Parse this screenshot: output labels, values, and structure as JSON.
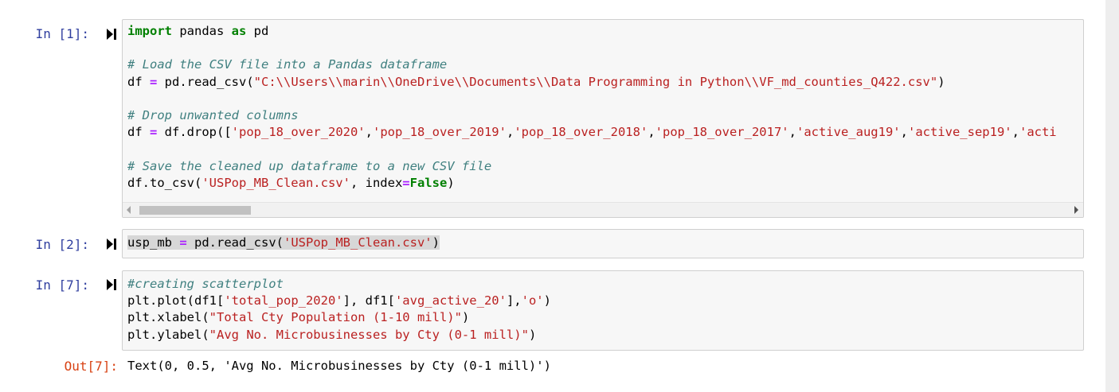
{
  "cells": [
    {
      "prompt": "In [1]:",
      "lines": [
        [
          {
            "t": "kw",
            "v": "import"
          },
          {
            "t": "",
            "v": " pandas "
          },
          {
            "t": "kw",
            "v": "as"
          },
          {
            "t": "",
            "v": " pd"
          }
        ],
        [],
        [
          {
            "t": "cm",
            "v": "# Load the CSV file into a Pandas dataframe"
          }
        ],
        [
          {
            "t": "",
            "v": "df "
          },
          {
            "t": "op",
            "v": "="
          },
          {
            "t": "",
            "v": " pd.read_csv("
          },
          {
            "t": "str",
            "v": "\"C:\\\\Users\\\\marin\\\\OneDrive\\\\Documents\\\\Data Programming in Python\\\\VF_md_counties_Q422.csv\""
          },
          {
            "t": "",
            "v": ")"
          }
        ],
        [],
        [
          {
            "t": "cm",
            "v": "# Drop unwanted columns"
          }
        ],
        [
          {
            "t": "",
            "v": "df "
          },
          {
            "t": "op",
            "v": "="
          },
          {
            "t": "",
            "v": " df.drop(["
          },
          {
            "t": "str",
            "v": "'pop_18_over_2020'"
          },
          {
            "t": "",
            "v": ","
          },
          {
            "t": "str",
            "v": "'pop_18_over_2019'"
          },
          {
            "t": "",
            "v": ","
          },
          {
            "t": "str",
            "v": "'pop_18_over_2018'"
          },
          {
            "t": "",
            "v": ","
          },
          {
            "t": "str",
            "v": "'pop_18_over_2017'"
          },
          {
            "t": "",
            "v": ","
          },
          {
            "t": "str",
            "v": "'active_aug19'"
          },
          {
            "t": "",
            "v": ","
          },
          {
            "t": "str",
            "v": "'active_sep19'"
          },
          {
            "t": "",
            "v": ","
          },
          {
            "t": "str",
            "v": "'acti"
          }
        ],
        [],
        [
          {
            "t": "cm",
            "v": "# Save the cleaned up dataframe to a new CSV file"
          }
        ],
        [
          {
            "t": "",
            "v": "df.to_csv("
          },
          {
            "t": "str",
            "v": "'USPop_MB_Clean.csv'"
          },
          {
            "t": "",
            "v": ", index"
          },
          {
            "t": "op",
            "v": "="
          },
          {
            "t": "kw",
            "v": "False"
          },
          {
            "t": "",
            "v": ")"
          }
        ]
      ]
    },
    {
      "prompt": "In [2]:",
      "lines": [
        [
          {
            "t": "hl",
            "v": "usp_mb "
          },
          {
            "t": "op hl",
            "v": "="
          },
          {
            "t": "hl",
            "v": " pd.read_csv("
          },
          {
            "t": "str hl",
            "v": "'USPop_MB_Clean.csv'"
          },
          {
            "t": "hl",
            "v": ")"
          }
        ]
      ]
    },
    {
      "prompt": "In [7]:",
      "lines": [
        [
          {
            "t": "cm",
            "v": "#creating scatterplot"
          }
        ],
        [
          {
            "t": "",
            "v": "plt.plot(df1["
          },
          {
            "t": "str",
            "v": "'total_pop_2020'"
          },
          {
            "t": "",
            "v": "], df1["
          },
          {
            "t": "str",
            "v": "'avg_active_20'"
          },
          {
            "t": "",
            "v": "],"
          },
          {
            "t": "str",
            "v": "'o'"
          },
          {
            "t": "",
            "v": ")"
          }
        ],
        [
          {
            "t": "",
            "v": "plt.xlabel("
          },
          {
            "t": "str",
            "v": "\"Total Cty Population (1-10 mill)\""
          },
          {
            "t": "",
            "v": ")"
          }
        ],
        [
          {
            "t": "",
            "v": "plt.ylabel("
          },
          {
            "t": "str",
            "v": "\"Avg No. Microbusinesses by Cty (0-1 mill)\""
          },
          {
            "t": "",
            "v": ")"
          }
        ]
      ]
    }
  ],
  "output": {
    "prompt": "Out[7]:",
    "text": "Text(0, 0.5, 'Avg No. Microbusinesses by Cty (0-1 mill)')"
  },
  "icons": {
    "run": "run-step-icon",
    "scroll_left": "arrow-left-icon",
    "scroll_right": "arrow-right-icon"
  }
}
